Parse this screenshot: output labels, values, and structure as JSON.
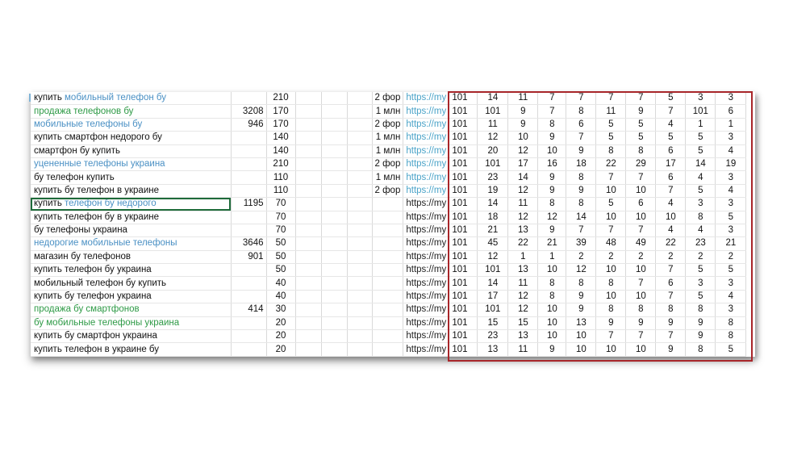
{
  "rows": [
    {
      "kw_plain": "купить ",
      "kw_hl": "мобильный телефон бу",
      "hl": "blue",
      "vol": "",
      "pos": "210",
      "note": "2 фор",
      "url": "https://my",
      "vals": [
        "101",
        "14",
        "11",
        "7",
        "7",
        "7",
        "7",
        "5",
        "3",
        "3"
      ]
    },
    {
      "kw_plain": "",
      "kw_hl": "продажа телефонов бу",
      "hl": "green",
      "vol": "3208",
      "pos": "170",
      "note": "1 млн",
      "url": "https://my",
      "vals": [
        "101",
        "101",
        "9",
        "7",
        "8",
        "11",
        "9",
        "7",
        "101",
        "6"
      ]
    },
    {
      "kw_plain": "",
      "kw_hl": "мобильные телефоны бу",
      "hl": "blue",
      "vol": "946",
      "pos": "170",
      "note": "2 фор",
      "url": "https://my",
      "vals": [
        "101",
        "11",
        "9",
        "8",
        "6",
        "5",
        "5",
        "4",
        "1",
        "1"
      ]
    },
    {
      "kw_plain": "купить смартфон недорого бу",
      "kw_hl": "",
      "hl": "",
      "vol": "",
      "pos": "140",
      "note": "1 млн",
      "url": "https://my",
      "vals": [
        "101",
        "12",
        "10",
        "9",
        "7",
        "5",
        "5",
        "5",
        "5",
        "3"
      ]
    },
    {
      "kw_plain": "смартфон бу купить",
      "kw_hl": "",
      "hl": "",
      "vol": "",
      "pos": "140",
      "note": "1 млн",
      "url": "https://my",
      "vals": [
        "101",
        "20",
        "12",
        "10",
        "9",
        "8",
        "8",
        "6",
        "5",
        "4"
      ]
    },
    {
      "kw_plain": "",
      "kw_hl": "уцененные телефоны украина",
      "hl": "blue",
      "vol": "",
      "pos": "210",
      "note": "2 фор",
      "url": "https://my",
      "vals": [
        "101",
        "101",
        "17",
        "16",
        "18",
        "22",
        "29",
        "17",
        "14",
        "19"
      ]
    },
    {
      "kw_plain": "бу телефон купить",
      "kw_hl": "",
      "hl": "",
      "vol": "",
      "pos": "110",
      "note": "1 млн",
      "url": "https://my",
      "vals": [
        "101",
        "23",
        "14",
        "9",
        "8",
        "7",
        "7",
        "6",
        "4",
        "3"
      ]
    },
    {
      "kw_plain": "купить бу телефон в украине",
      "kw_hl": "",
      "hl": "",
      "vol": "",
      "pos": "110",
      "note": "2 фор",
      "url": "https://my",
      "vals": [
        "101",
        "19",
        "12",
        "9",
        "9",
        "10",
        "10",
        "7",
        "5",
        "4"
      ]
    },
    {
      "kw_plain": "купить ",
      "kw_hl": "телефон бу недорого",
      "hl": "blue",
      "vol": "1195",
      "pos": "70",
      "note": "",
      "url": "https://my",
      "vals": [
        "101",
        "14",
        "11",
        "8",
        "8",
        "5",
        "6",
        "4",
        "3",
        "3"
      ]
    },
    {
      "kw_plain": "купить телефон бу в украине",
      "kw_hl": "",
      "hl": "",
      "vol": "",
      "pos": "70",
      "note": "",
      "url": "https://my",
      "vals": [
        "101",
        "18",
        "12",
        "12",
        "14",
        "10",
        "10",
        "10",
        "8",
        "5"
      ]
    },
    {
      "kw_plain": "бу телефоны украина",
      "kw_hl": "",
      "hl": "",
      "vol": "",
      "pos": "70",
      "note": "",
      "url": "https://my",
      "vals": [
        "101",
        "21",
        "13",
        "9",
        "7",
        "7",
        "7",
        "4",
        "4",
        "3"
      ]
    },
    {
      "kw_plain": "",
      "kw_hl": "недорогие мобильные телефоны",
      "hl": "blue",
      "vol": "3646",
      "pos": "50",
      "note": "",
      "url": "https://my",
      "vals": [
        "101",
        "45",
        "22",
        "21",
        "39",
        "48",
        "49",
        "22",
        "23",
        "21"
      ]
    },
    {
      "kw_plain": "магазин бу телефонов",
      "kw_hl": "",
      "hl": "",
      "vol": "901",
      "pos": "50",
      "note": "",
      "url": "https://my",
      "vals": [
        "101",
        "12",
        "1",
        "1",
        "2",
        "2",
        "2",
        "2",
        "2",
        "2"
      ]
    },
    {
      "kw_plain": "купить телефон бу украина",
      "kw_hl": "",
      "hl": "",
      "vol": "",
      "pos": "50",
      "note": "",
      "url": "https://my",
      "vals": [
        "101",
        "101",
        "13",
        "10",
        "12",
        "10",
        "10",
        "7",
        "5",
        "5"
      ]
    },
    {
      "kw_plain": "мобильный телефон бу купить",
      "kw_hl": "",
      "hl": "",
      "vol": "",
      "pos": "40",
      "note": "",
      "url": "https://my",
      "vals": [
        "101",
        "14",
        "11",
        "8",
        "8",
        "8",
        "7",
        "6",
        "3",
        "3"
      ]
    },
    {
      "kw_plain": "купить бу телефон украина",
      "kw_hl": "",
      "hl": "",
      "vol": "",
      "pos": "40",
      "note": "",
      "url": "https://my",
      "vals": [
        "101",
        "17",
        "12",
        "8",
        "9",
        "10",
        "10",
        "7",
        "5",
        "4"
      ]
    },
    {
      "kw_plain": "",
      "kw_hl": "продажа бу смартфонов",
      "hl": "green",
      "vol": "414",
      "pos": "30",
      "note": "",
      "url": "https://my",
      "vals": [
        "101",
        "101",
        "12",
        "10",
        "9",
        "8",
        "8",
        "8",
        "8",
        "3"
      ]
    },
    {
      "kw_plain": "",
      "kw_hl": "бу мобильные телефоны украина",
      "hl": "green",
      "vol": "",
      "pos": "20",
      "note": "",
      "url": "https://my",
      "vals": [
        "101",
        "15",
        "15",
        "10",
        "13",
        "9",
        "9",
        "9",
        "9",
        "8"
      ]
    },
    {
      "kw_plain": "купить бу смартфон украина",
      "kw_hl": "",
      "hl": "",
      "vol": "",
      "pos": "20",
      "note": "",
      "url": "https://my",
      "vals": [
        "101",
        "23",
        "13",
        "10",
        "10",
        "7",
        "7",
        "7",
        "9",
        "8"
      ]
    },
    {
      "kw_plain": "купить телефон в украине бу",
      "kw_hl": "",
      "hl": "",
      "vol": "",
      "pos": "20",
      "note": "",
      "url": "https://my",
      "vals": [
        "101",
        "13",
        "11",
        "9",
        "10",
        "10",
        "10",
        "9",
        "8",
        "5"
      ]
    }
  ],
  "colors": {
    "blue": "#4a90c4",
    "green": "#2e9a46",
    "highlight_border": "#a8262a",
    "selected_cell": "#1e6b3a"
  },
  "selected_row": 8
}
